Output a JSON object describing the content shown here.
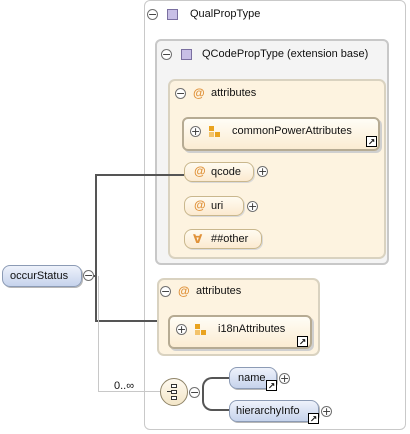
{
  "root": {
    "label": "occurStatus"
  },
  "type": {
    "label": "QualPropType"
  },
  "base": {
    "label": "QCodePropType (extension base)"
  },
  "attributes_a": {
    "label": "attributes",
    "group": "commonPowerAttributes",
    "items": [
      "qcode",
      "uri"
    ],
    "any": "##other"
  },
  "attributes_b": {
    "label": "attributes",
    "group": "i18nAttributes"
  },
  "sequence": {
    "cardinality": "0..∞",
    "children": [
      "name",
      "hierarchyInfo"
    ]
  },
  "icons": {
    "collapse": "−",
    "expand": "+",
    "attribute": "@",
    "any_attribute": "∀",
    "link": "↗"
  }
}
